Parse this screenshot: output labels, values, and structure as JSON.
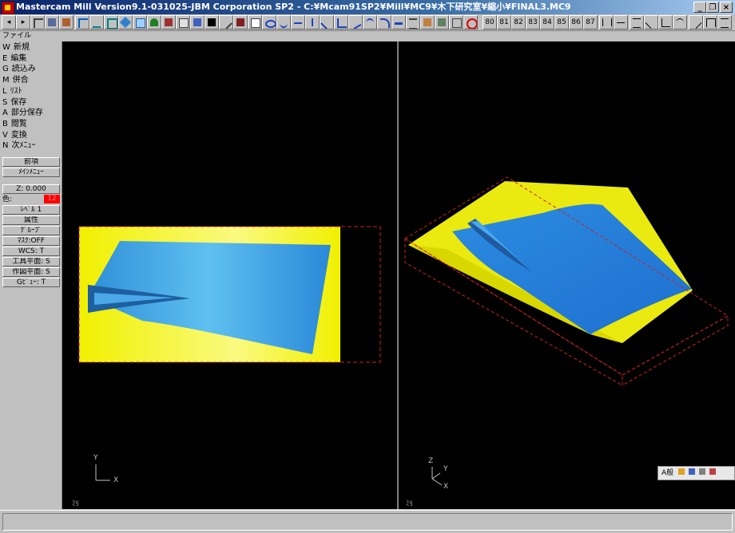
{
  "window": {
    "title": "Mastercam Mill Version9.1-031025-JBM Corporation SP2 - C:¥Mcam91SP2¥Mill¥MC9¥木下研究室¥縮小¥FINAL3.MC9",
    "min_label": "_",
    "max_label": "❐",
    "close_label": "×"
  },
  "toolbar": {
    "numbered": [
      "80",
      "81",
      "82",
      "83",
      "84",
      "85",
      "86",
      "87"
    ]
  },
  "menu_label": "ファイル",
  "file_menu": [
    {
      "key": "W",
      "label": "新規"
    },
    {
      "key": "E",
      "label": "編集"
    },
    {
      "key": "G",
      "label": "読込み"
    },
    {
      "key": "M",
      "label": "併合"
    },
    {
      "key": "L",
      "label": "ﾘｽﾄ"
    },
    {
      "key": "S",
      "label": "保存"
    },
    {
      "key": "A",
      "label": "部分保存"
    },
    {
      "key": "B",
      "label": "閲覧"
    },
    {
      "key": "V",
      "label": "変換"
    },
    {
      "key": "N",
      "label": "次ﾒﾆｭｰ"
    }
  ],
  "nav": {
    "previous": "前項",
    "main_menu": "ﾒｲﾝﾒﾆｭｰ"
  },
  "settings": {
    "z": "Z:   0.000",
    "color_label": "色:",
    "color_value": "12",
    "level": "ﾚﾍﾞﾙ 1",
    "attributes": "属性",
    "group": "ｸﾞﾙｰﾌﾟ",
    "mask": "ﾏｽｸ:OFF",
    "wcs": "WCS:  T",
    "tool_plane": "工具平面:  S",
    "construction_plane": "作図平面:  S",
    "gview": "Gﾋﾞｭｰ:  T"
  },
  "viewports": {
    "left": {
      "axis_x": "X",
      "axis_y": "Y",
      "units": "ﾐﾘ"
    },
    "right": {
      "axis_x": "X",
      "axis_y": "Y",
      "axis_z": "Z",
      "units": "ﾐﾘ"
    }
  },
  "mini_toolbar": {
    "label": "A般"
  },
  "colors": {
    "surface_yellow": "#f0f000",
    "surface_blue": "#2a8fe0",
    "bounding_box": "#d02020",
    "title_bar": "#0a246a"
  }
}
